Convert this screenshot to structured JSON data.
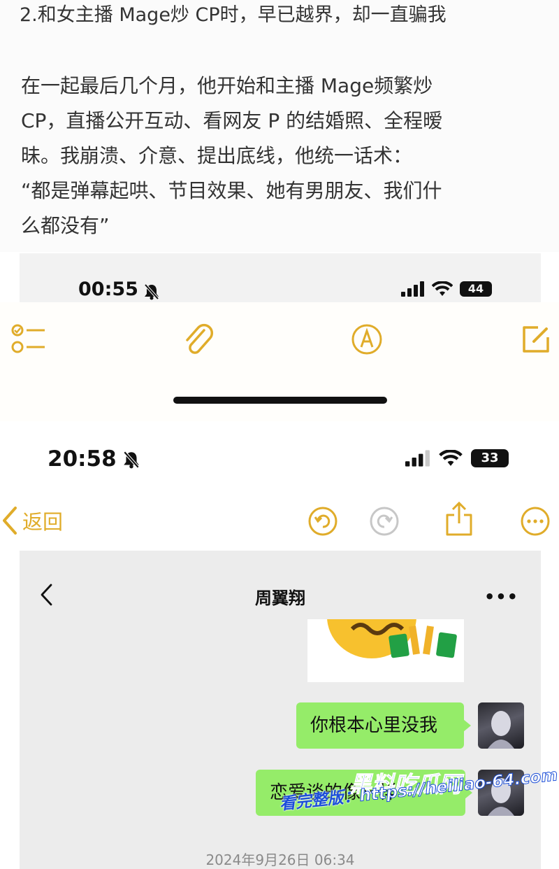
{
  "article": {
    "headline": "2.和女主播 Mage炒 CP时，早已越界，却一直骗我",
    "paragraph_lines": [
      "在一起最后几个月，他开始和主播 Mage频繁炒",
      " CP，直播公开互动、看网友 P 的结婚照、全程暧",
      "昧。我崩溃、介意、提出底线，他统一话术：",
      "“都是弹幕起哄、节目效果、她有男朋友、我们什",
      "么都没有”"
    ]
  },
  "screenshot1": {
    "time": "00:55",
    "battery": "44",
    "toolbar_icons": [
      "checklist-icon",
      "paperclip-icon",
      "markup-pen-icon",
      "compose-icon"
    ]
  },
  "screenshot2": {
    "time": "20:58",
    "battery": "33",
    "nav": {
      "back_label": "返回",
      "icons": [
        "undo-icon",
        "redo-icon",
        "share-icon",
        "more-circle-icon"
      ]
    }
  },
  "chat": {
    "contact_name": "周翼翔",
    "more_label": "•••",
    "messages": [
      {
        "side": "right",
        "text": "你根本心里没我"
      },
      {
        "side": "right",
        "text": "恋爱谈的像一样"
      }
    ],
    "timestamp": "2024年9月26日 06:34"
  },
  "watermark": {
    "brand": "黑料吃瓜网",
    "url_label": "看完整版：",
    "url": "https://heiliao-64.com"
  },
  "colors": {
    "accent_yellow": "#e0ac2a",
    "bubble_green": "#95ec69",
    "chat_bg": "#ececec",
    "watermark_blue": "#1d4fd8"
  }
}
